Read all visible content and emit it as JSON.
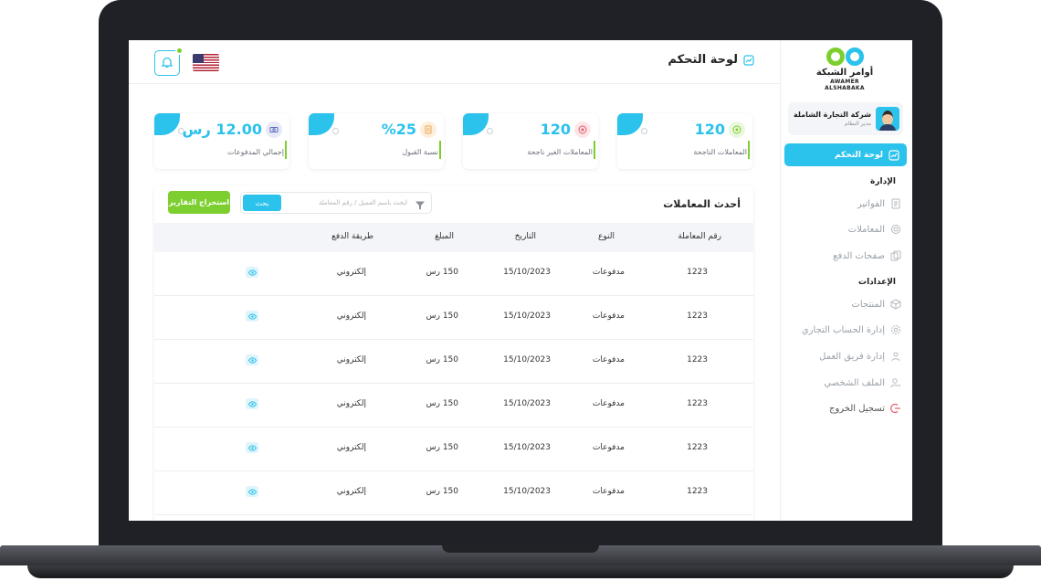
{
  "colors": {
    "primary": "#2bc2ec",
    "accent_green": "#7dcf2f",
    "text_dark": "#222222",
    "text_muted": "#9aa0a8"
  },
  "brand": {
    "name_ar": "أوامر الشبكة",
    "name_en": "AWAMER ALSHABAKA"
  },
  "user": {
    "name": "شركة التجارة الشاملة",
    "role": "مدير النظام"
  },
  "sidebar": {
    "active_item": {
      "label": "لوحة التحكم",
      "icon": "dashboard-icon"
    },
    "sections": [
      {
        "title": "الإدارة",
        "items": [
          {
            "label": "الفواتير",
            "icon": "invoice-icon"
          },
          {
            "label": "المعاملات",
            "icon": "transactions-icon"
          },
          {
            "label": "صفحات الدفع",
            "icon": "payment-pages-icon"
          }
        ]
      },
      {
        "title": "الإعدادات",
        "items": [
          {
            "label": "المنتجات",
            "icon": "box-icon"
          },
          {
            "label": "إدارة الحساب التجاري",
            "icon": "settings-icon"
          },
          {
            "label": "إدارة فريق العمل",
            "icon": "team-icon"
          },
          {
            "label": "الملف الشخصي",
            "icon": "user-icon"
          },
          {
            "label": "تسجيل الخروج",
            "icon": "logout-icon"
          }
        ]
      }
    ]
  },
  "header": {
    "title": "لوحة التحكم",
    "title_icon": "dashboard-icon",
    "notification_icon": "bell-icon",
    "language_flag": "us-flag-icon"
  },
  "stats": [
    {
      "value": "120",
      "label": "المعاملات الناجحة",
      "icon": "success-icon",
      "icon_color": "#7dcf2f"
    },
    {
      "value": "120",
      "label": "المعاملات الغير ناجحة",
      "icon": "failed-icon",
      "icon_color": "#e85a6a"
    },
    {
      "value": "%25",
      "label": "نسبة القبول",
      "icon": "document-icon",
      "icon_color": "#f0a24a"
    },
    {
      "value": "12.00 رس",
      "label": "إجمالي المدفوعات",
      "icon": "money-icon",
      "icon_color": "#5a6cbf"
    }
  ],
  "transactions": {
    "title": "أحدث المعاملات",
    "search_placeholder": "ابحث باسم العميل / رقم المعاملة",
    "search_button": "بحث",
    "export_button": "استخراج التقارير",
    "columns": [
      "رقم المعاملة",
      "النوع",
      "التاريخ",
      "المبلغ",
      "طريقة الدفع"
    ],
    "rows": [
      {
        "id": "1223",
        "type": "مدفوعات",
        "date": "15/10/2023",
        "amount": "150 رس",
        "method": "إلكتروني"
      },
      {
        "id": "1223",
        "type": "مدفوعات",
        "date": "15/10/2023",
        "amount": "150 رس",
        "method": "إلكتروني"
      },
      {
        "id": "1223",
        "type": "مدفوعات",
        "date": "15/10/2023",
        "amount": "150 رس",
        "method": "إلكتروني"
      },
      {
        "id": "1223",
        "type": "مدفوعات",
        "date": "15/10/2023",
        "amount": "150 رس",
        "method": "إلكتروني"
      },
      {
        "id": "1223",
        "type": "مدفوعات",
        "date": "15/10/2023",
        "amount": "150 رس",
        "method": "إلكتروني"
      },
      {
        "id": "1223",
        "type": "مدفوعات",
        "date": "15/10/2023",
        "amount": "150 رس",
        "method": "إلكتروني"
      }
    ]
  }
}
